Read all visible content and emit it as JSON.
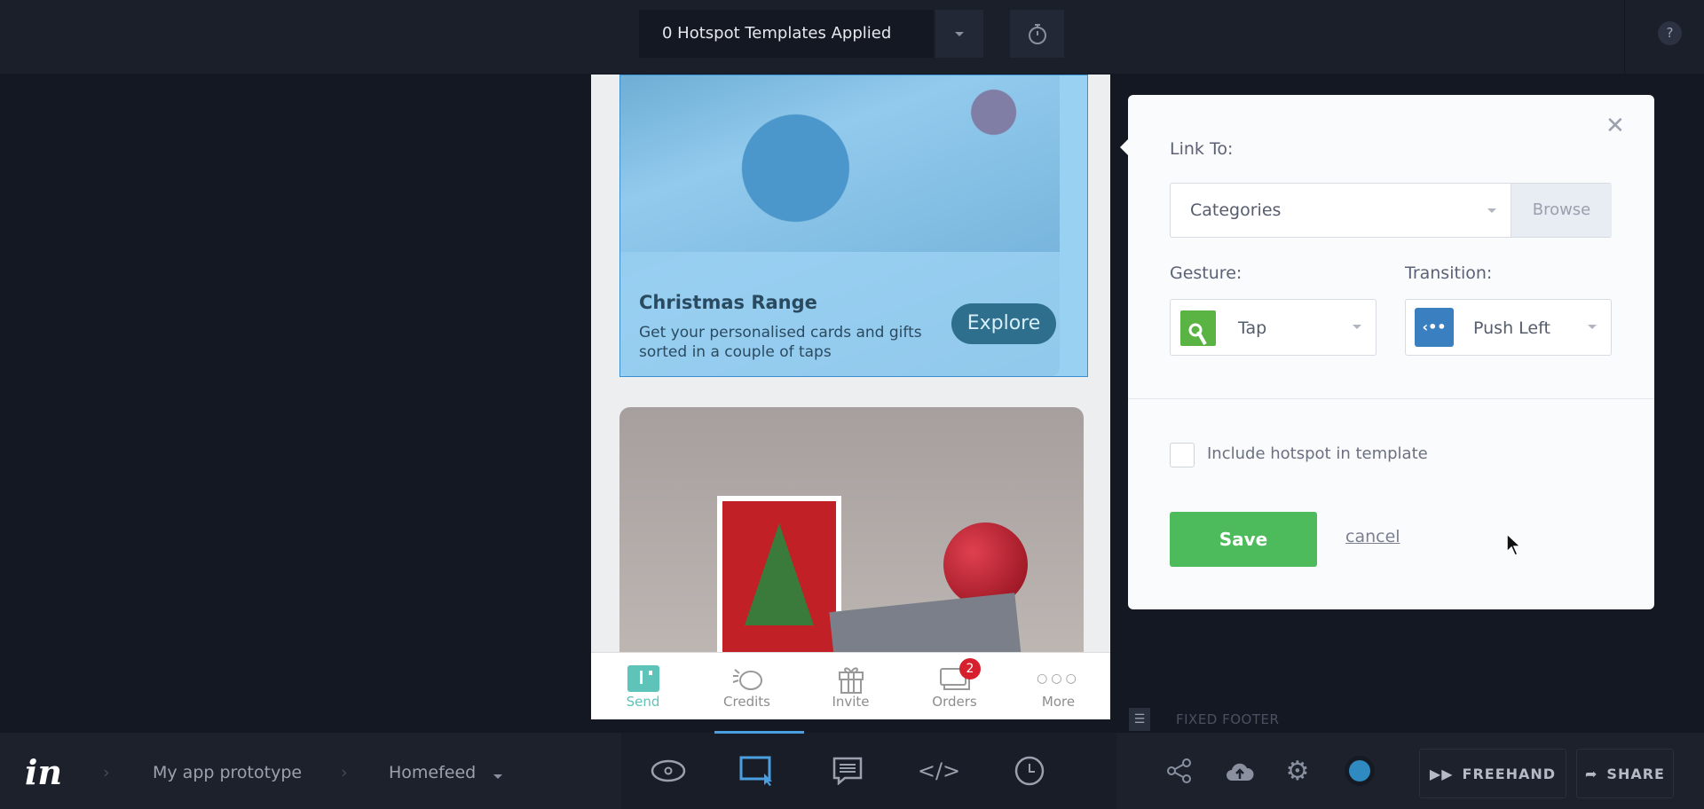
{
  "topbar": {
    "templates_label": "0 Hotspot Templates Applied",
    "help": "?"
  },
  "phone": {
    "card1": {
      "title": "Christmas Range",
      "description": "Get your personalised cards and gifts sorted in a couple of taps",
      "button": "Explore"
    },
    "tabs": [
      {
        "label": "Send",
        "icon": "send-icon"
      },
      {
        "label": "Credits",
        "icon": "credits-icon"
      },
      {
        "label": "Invite",
        "icon": "gift-icon"
      },
      {
        "label": "Orders",
        "icon": "orders-icon",
        "badge": "2"
      },
      {
        "label": "More",
        "icon": "more-icon"
      }
    ],
    "fixed_footer_label": "FIXED FOOTER"
  },
  "panel": {
    "link_to_label": "Link To:",
    "link_to_value": "Categories",
    "browse": "Browse",
    "gesture_label": "Gesture:",
    "gesture_value": "Tap",
    "transition_label": "Transition:",
    "transition_value": "Push Left",
    "include_label": "Include hotspot in template",
    "include_checked": false,
    "save": "Save",
    "cancel": "cancel"
  },
  "bottombar": {
    "breadcrumbs": [
      "My app prototype",
      "Homefeed"
    ],
    "freehand": "FREEHAND",
    "share": "SHARE",
    "active_tool": "hotspot"
  },
  "colors": {
    "accent": "#4a9fe0",
    "save": "#4dbb5b",
    "tap": "#5ab443",
    "push": "#3a7fc0",
    "badge": "#d7202e",
    "send": "#5ec3b8"
  }
}
